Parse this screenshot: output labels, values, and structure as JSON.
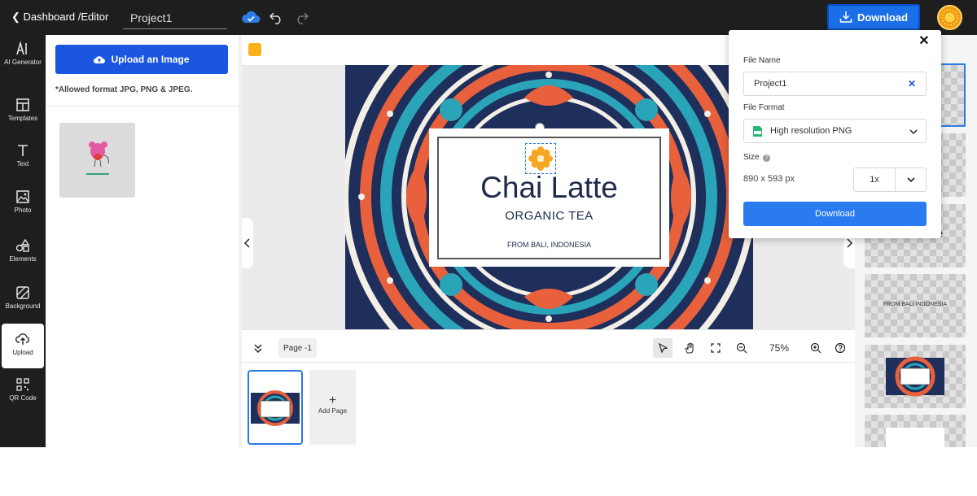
{
  "topbar": {
    "breadcrumb": "Dashboard /Editor",
    "project_name": "Project1",
    "download_label": "Download"
  },
  "sidebar": {
    "items": [
      {
        "label": "AI Generator",
        "icon": "ai-icon"
      },
      {
        "label": "Templates",
        "icon": "templates-icon"
      },
      {
        "label": "Text",
        "icon": "text-icon"
      },
      {
        "label": "Photo",
        "icon": "photo-icon"
      },
      {
        "label": "Elements",
        "icon": "elements-icon"
      },
      {
        "label": "Background",
        "icon": "background-icon"
      },
      {
        "label": "Upload",
        "icon": "upload-icon"
      },
      {
        "label": "QR Code",
        "icon": "qr-code-icon"
      }
    ],
    "active": "Upload"
  },
  "panel": {
    "upload_button": "Upload an Image",
    "allowed_formats": "*Allowed format JPG, PNG & JPEG."
  },
  "canvas": {
    "title": "Chai Latte",
    "subtitle": "ORGANIC TEA",
    "from": "FROM BALI, INDONESIA"
  },
  "toolbar": {
    "page_label": "Page -1",
    "zoom": "75%"
  },
  "pages": {
    "add_page_label": "Add Page"
  },
  "download_popup": {
    "file_name_label": "File Name",
    "file_name_value": "Project1",
    "file_format_label": "File Format",
    "file_format_value": "High resolution PNG",
    "size_label": "Size",
    "size_value": "890 x 593 px",
    "scale_value": "1x",
    "download_button": "Download"
  },
  "layers": {
    "items": [
      {
        "text": "Chai Latte"
      },
      {
        "text": "FROM BALI INDONESIA"
      }
    ]
  },
  "colors": {
    "topbar": "#1e1e1e",
    "accent": "#1a56e0",
    "download_primary": "#2a7bf0",
    "swatch": "#fbb11a"
  }
}
